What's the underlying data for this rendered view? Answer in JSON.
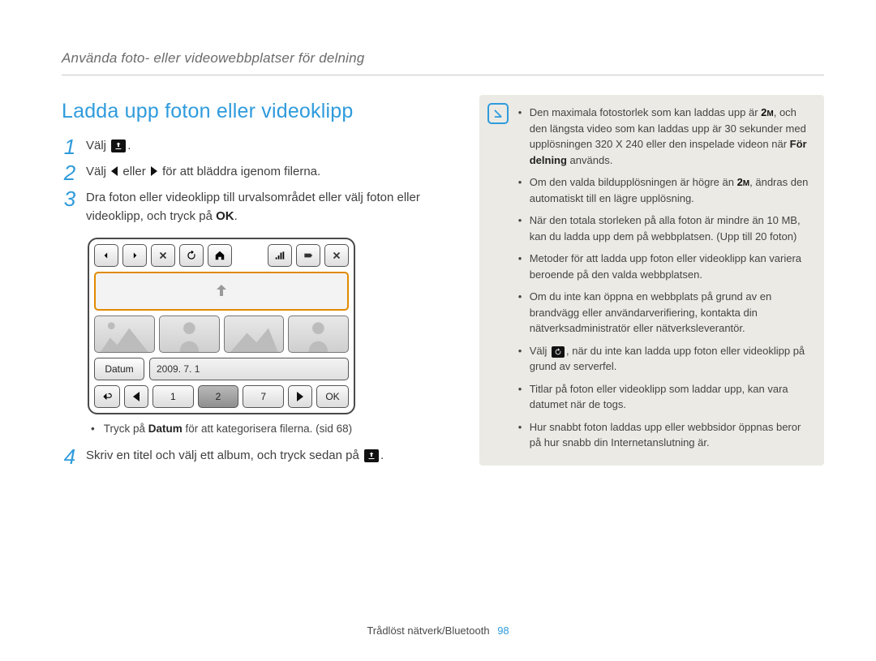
{
  "header": "Använda foto- eller videowebbplatser för delning",
  "title": "Ladda upp foton eller videoklipp",
  "steps": {
    "s1": "Välj",
    "s2_a": "Välj",
    "s2_b": "eller",
    "s2_c": "för att bläddra igenom filerna.",
    "s3_a": "Dra foton eller videoklipp till urvalsområdet eller välj foton eller videoklipp, och tryck på ",
    "s3_b": "OK",
    "s3_c": ".",
    "s4_a": "Skriv en titel och välj ett album, och tryck sedan på",
    "s4_b": "."
  },
  "camera": {
    "datum": "Datum",
    "date": "2009. 7. 1",
    "nums": [
      "1",
      "2",
      "7"
    ],
    "ok": "OK"
  },
  "subnote_a": "Tryck på ",
  "subnote_b": "Datum",
  "subnote_c": " för att kategorisera filerna. (sid 68)",
  "tips": {
    "b1_a": "Den maximala fotostorlek som kan laddas upp är ",
    "b1_b": ", och den längsta video som kan laddas upp är 30 sekunder med upplösningen 320 X 240 eller den inspelade videon när ",
    "b1_c": "För delning",
    "b1_d": " används.",
    "b2_a": "Om den valda bildupplösningen är högre än ",
    "b2_b": ", ändras den automatiskt till en lägre upplösning.",
    "b3": "När den totala storleken på alla foton är mindre än 10 MB, kan du ladda upp dem på webbplatsen. (Upp till 20 foton)",
    "b4": "Metoder för att ladda upp foton eller videoklipp kan variera beroende på den valda webbplatsen.",
    "b5": "Om du inte kan öppna en webbplats på grund av en brandvägg eller användarverifiering, kontakta din nätverksadministratör eller nätverksleverantör.",
    "b6_a": "Välj ",
    "b6_b": ", när du inte kan ladda upp foton eller videoklipp på grund av serverfel.",
    "b7": "Titlar på foton eller videoklipp som laddar upp, kan vara datumet när de togs.",
    "b8": "Hur snabbt foton laddas upp eller webbsidor öppnas beror på hur snabb din Internetanslutning är."
  },
  "footer": {
    "section": "Trådlöst nätverk/Bluetooth",
    "page": "98"
  }
}
